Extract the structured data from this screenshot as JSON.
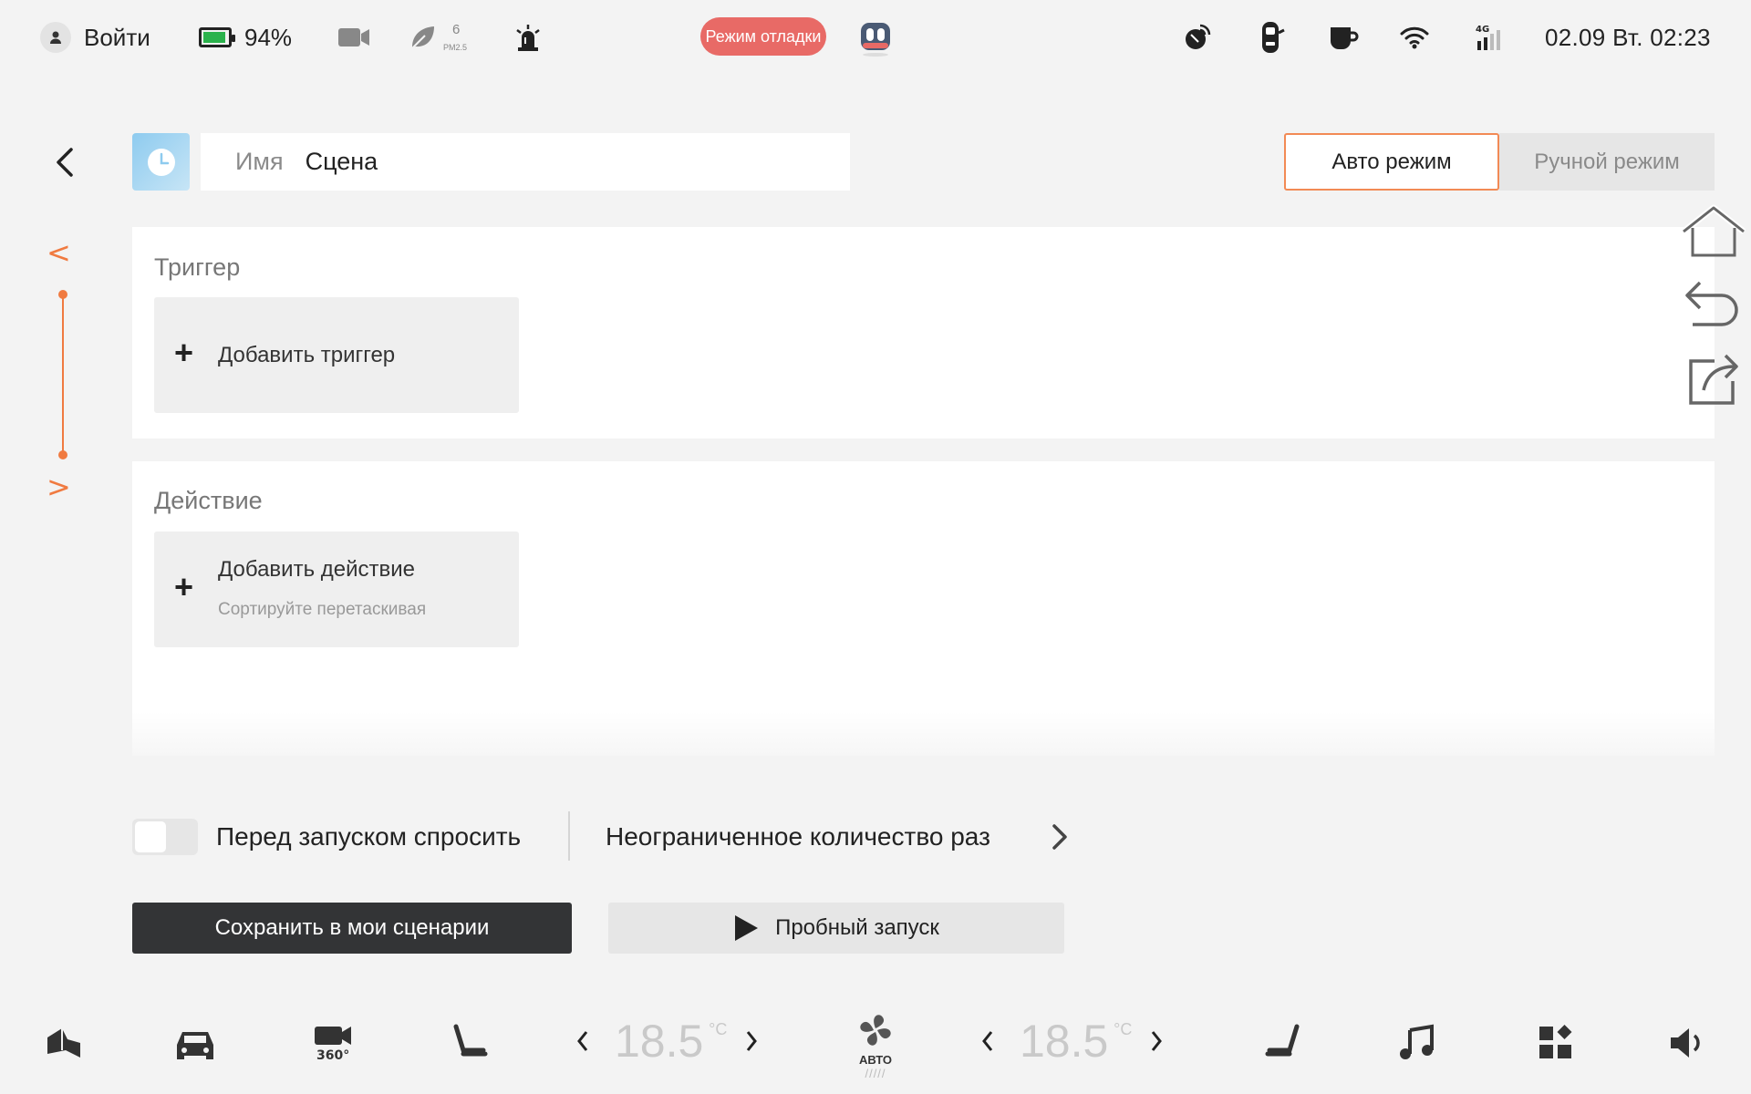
{
  "status_bar": {
    "login": "Войти",
    "battery": "94%",
    "pm_value": "6",
    "pm_label": "PM2.5",
    "debug_badge": "Режим отладки",
    "network": "4G",
    "datetime": "02.09 Вт. 02:23"
  },
  "header": {
    "name_label": "Имя",
    "name_value": "Сцена",
    "mode_auto": "Авто режим",
    "mode_manual": "Ручной режим"
  },
  "trigger": {
    "title": "Триггер",
    "add_label": "Добавить триггер"
  },
  "action": {
    "title": "Действие",
    "add_label": "Добавить действие",
    "hint": "Сортируйте перетаскивая"
  },
  "options": {
    "ask_before_run": "Перед запуском спросить",
    "ask_before_run_enabled": false,
    "run_count": "Неограниченное количество раз"
  },
  "buttons": {
    "save": "Сохранить в мои сценарии",
    "trial": "Пробный запуск"
  },
  "dock": {
    "temp_left": "18.5",
    "temp_right": "18.5",
    "temp_unit": "°C",
    "fan_label": "АВТО"
  },
  "colors": {
    "accent": "#f07a40",
    "debug_badge": "#e86a66",
    "battery": "#2bb24c"
  }
}
